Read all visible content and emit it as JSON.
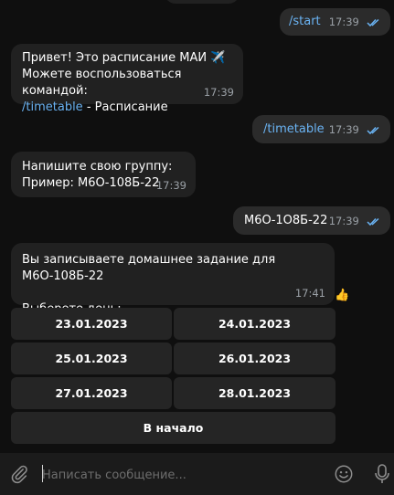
{
  "messages": [
    {
      "text": "/start",
      "time": "17:39"
    },
    {
      "line1": "Привет! Это расписание МАИ",
      "emoji": "✈️",
      "line2": "Можете воспользоваться командой:",
      "command": "/timetable",
      "desc": " - Расписание",
      "time": "17:39"
    },
    {
      "text": "/timetable",
      "time": "17:39"
    },
    {
      "line1": "Напишите свою группу:",
      "line2": "Пример: М6О-108Б-22",
      "time": "17:39"
    },
    {
      "text": "М6О-1О8Б-22",
      "time": "17:39"
    },
    {
      "line1": "Вы записываете домашнее задание для М6О-108Б-22",
      "line2": "Выберете день:",
      "time": "17:41",
      "reaction": "👍"
    }
  ],
  "keyboard": {
    "buttons": [
      "23.01.2023",
      "24.01.2023",
      "25.01.2023",
      "26.01.2023",
      "27.01.2023",
      "28.01.2023"
    ],
    "back": "В начало"
  },
  "composer": {
    "placeholder": "Написать сообщение..."
  },
  "colors": {
    "background": "#0f0f0f",
    "bubble": "#212121",
    "link": "#6ab3f3",
    "checks": "#6ab3f3"
  }
}
